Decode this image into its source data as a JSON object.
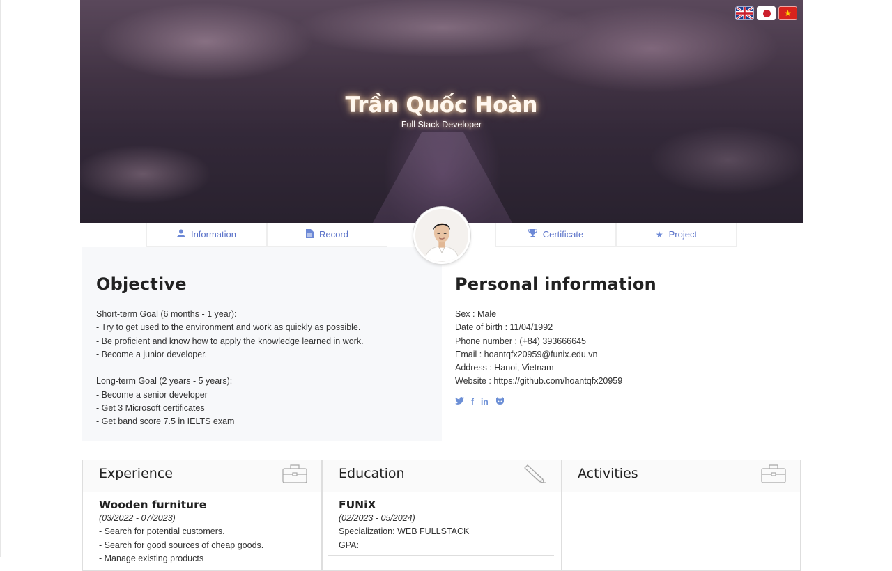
{
  "header": {
    "name": "Trần Quốc Hoàn",
    "role": "Full Stack Developer",
    "languages": [
      {
        "code": "en",
        "icon": "uk-flag-icon"
      },
      {
        "code": "ja",
        "icon": "japan-flag-icon"
      },
      {
        "code": "vi",
        "icon": "vietnam-flag-icon"
      }
    ]
  },
  "nav": {
    "tabs": [
      {
        "label": "Information",
        "icon": "user-icon"
      },
      {
        "label": "Record",
        "icon": "document-icon"
      },
      {
        "label": "Certificate",
        "icon": "trophy-icon"
      },
      {
        "label": "Project",
        "icon": "star-icon"
      }
    ],
    "avatar": "profile-photo"
  },
  "objective": {
    "title": "Objective",
    "lines": [
      "Short-term Goal (6 months - 1 year):",
      "- Try to get used to the environment and work as quickly as possible.",
      "- Be proficient and know how to apply the knowledge learned in work.",
      "- Become a junior developer.",
      "",
      "Long-term Goal (2 years - 5 years):",
      "- Become a senior developer",
      "- Get 3 Microsoft certificates",
      "- Get band score 7.5 in IELTS exam"
    ]
  },
  "personal": {
    "title": "Personal information",
    "lines": [
      "Sex : Male",
      "Date of birth : 11/04/1992",
      "Phone number : (+84) 393666645",
      "Email : hoantqfx20959@funix.edu.vn",
      "Address : Hanoi, Vietnam",
      "Website : https://github.com/hoantqfx20959"
    ],
    "social": [
      {
        "icon": "twitter-icon",
        "glyph": "🐦"
      },
      {
        "icon": "facebook-icon",
        "glyph": "f"
      },
      {
        "icon": "linkedin-icon",
        "glyph": "in"
      },
      {
        "icon": "github-icon",
        "glyph": "☻"
      }
    ]
  },
  "experience": {
    "title": "Experience",
    "org": "Wooden furniture",
    "period": "(03/2022 - 07/2023)",
    "lines": [
      "- Search for potential customers.",
      "- Search for good sources of cheap goods.",
      "- Manage existing products"
    ]
  },
  "education": {
    "title": "Education",
    "org": "FUNiX",
    "period": "(02/2023 - 05/2024)",
    "lines": [
      "Specialization: WEB FULLSTACK",
      "GPA:"
    ]
  },
  "activities": {
    "title": "Activities"
  }
}
